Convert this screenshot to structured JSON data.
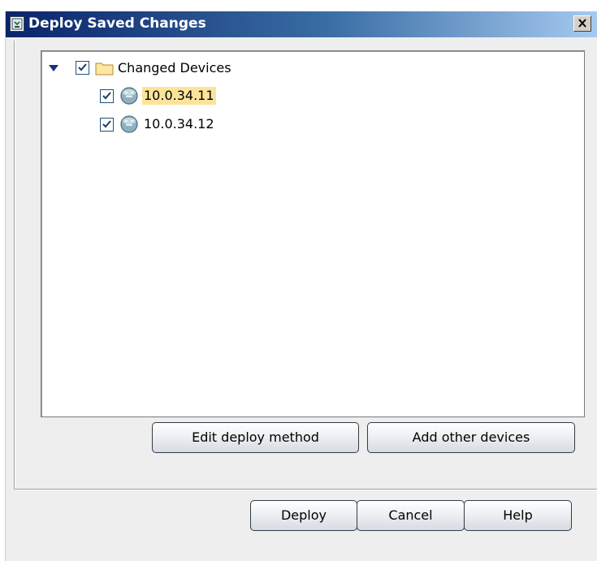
{
  "window": {
    "title": "Deploy Saved Changes",
    "close_glyph": "✕"
  },
  "tree": {
    "root": {
      "label": "Changed Devices",
      "checked": true,
      "expanded": true,
      "icon": "folder-icon"
    },
    "children": [
      {
        "label": "10.0.34.11",
        "checked": true,
        "selected": true,
        "icon": "router-icon"
      },
      {
        "label": "10.0.34.12",
        "checked": true,
        "selected": false,
        "icon": "router-icon"
      }
    ]
  },
  "actions": {
    "edit_deploy_method": "Edit deploy method",
    "add_other_devices": "Add other devices"
  },
  "footer": {
    "deploy": "Deploy",
    "cancel": "Cancel",
    "help": "Help"
  },
  "colors": {
    "titlebar_start": "#0a246a",
    "titlebar_end": "#a6caf0",
    "selection": "#fbe49a",
    "dialog_bg": "#eeeeee"
  }
}
